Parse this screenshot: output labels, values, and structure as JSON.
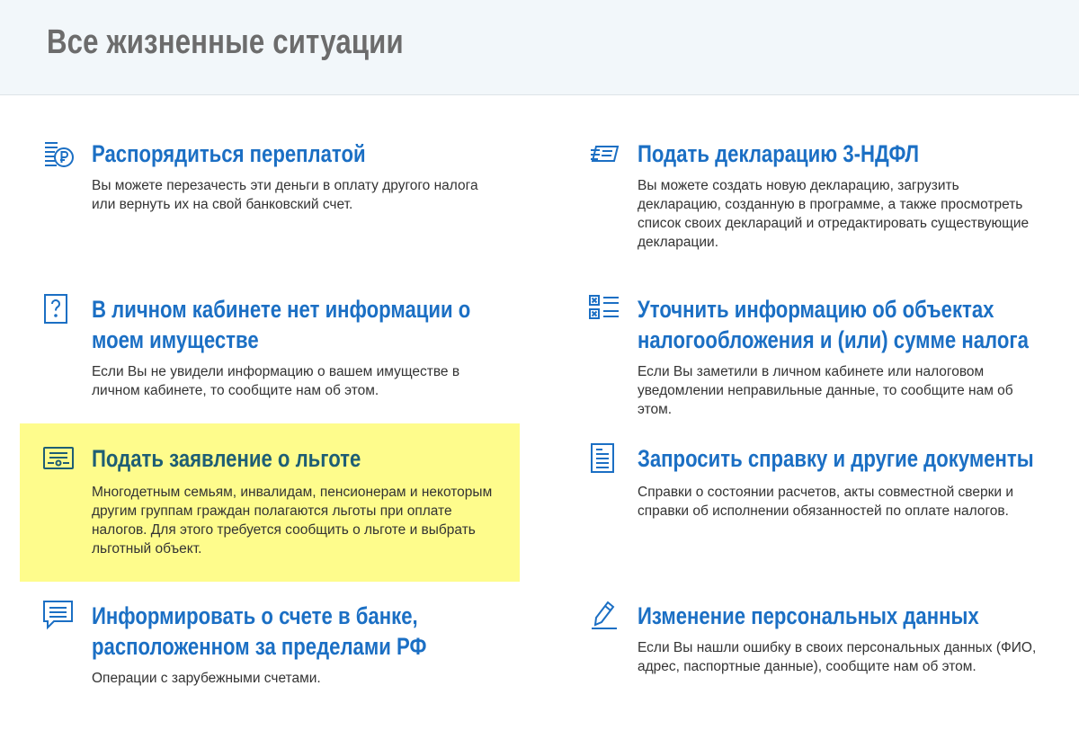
{
  "header": {
    "title": "Все жизненные ситуации"
  },
  "cards": [
    {
      "id": "overpayment",
      "icon": "coins-ruble-icon",
      "title": "Распорядиться переплатой",
      "description": "Вы можете перезачесть эти деньги в оплату другого налога или вернуть их на свой банковский счет."
    },
    {
      "id": "declaration",
      "icon": "documents-stack-icon",
      "title": "Подать декларацию 3-НДФЛ",
      "description": "Вы можете создать новую декларацию, загрузить декларацию, созданную в программе, а также просмотреть список своих деклараций и отредактировать существующие декларации."
    },
    {
      "id": "property-missing",
      "icon": "question-document-icon",
      "title": "В личном кабинете нет информации о моем имуществе",
      "description": "Если Вы не увидели информацию о вашем имуществе в личном кабинете, то сообщите нам об этом."
    },
    {
      "id": "clarify-objects",
      "icon": "checklist-x-icon",
      "title": "Уточнить информацию об объектах налогообложения и (или) сумме налога",
      "description": "Если Вы заметили в личном кабинете или налоговом уведомлении неправильные данные, то сообщите нам об этом."
    },
    {
      "id": "benefit",
      "icon": "certificate-icon",
      "title": "Подать заявление о льготе",
      "description": "Многодетным семьям, инвалидам, пенсионерам и некоторым другим группам граждан полагаются льготы при оплате налогов. Для этого требуется сообщить о льготе и выбрать льготный объект."
    },
    {
      "id": "documents",
      "icon": "document-lines-icon",
      "title": "Запросить справку и другие документы",
      "description": "Справки о состоянии расчетов, акты совместной сверки и справки об исполнении обязанностей по оплате налогов."
    },
    {
      "id": "foreign-account",
      "icon": "chat-message-icon",
      "title": "Информировать о счете в банке, расположенном за пределами РФ",
      "description": "Операции с зарубежными счетами."
    },
    {
      "id": "personal-data",
      "icon": "pencil-icon",
      "title": "Изменение персональных данных",
      "description": "Если Вы нашли ошибку в своих персональных данных (ФИО, адрес, паспортные данные), сообщите нам об этом."
    }
  ],
  "colors": {
    "link": "#1b6fc4",
    "highlight": "#fefc8c",
    "header_bg": "#f2f7fa"
  }
}
